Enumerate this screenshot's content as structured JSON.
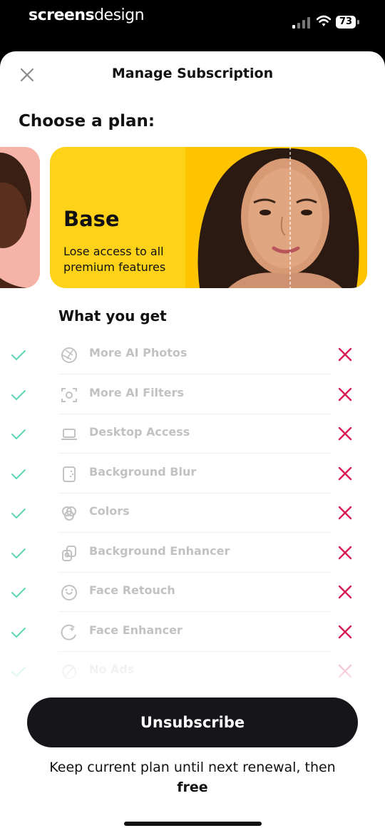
{
  "status_bar": {
    "brand_part1": "screens",
    "brand_part2": "design",
    "battery": "73"
  },
  "header": {
    "title": "Manage Subscription"
  },
  "section_title": "Choose a plan:",
  "plan_card": {
    "name": "Base",
    "description": "Lose access to all premium features"
  },
  "features_title": "What you get",
  "features": [
    {
      "label": "More AI Photos",
      "icon": "aperture-icon"
    },
    {
      "label": "More AI Filters",
      "icon": "face-scan-icon"
    },
    {
      "label": "Desktop Access",
      "icon": "laptop-icon"
    },
    {
      "label": "Background Blur",
      "icon": "blur-icon"
    },
    {
      "label": "Colors",
      "icon": "color-circles-icon"
    },
    {
      "label": "Background Enhancer",
      "icon": "enhance-icon"
    },
    {
      "label": "Face Retouch",
      "icon": "face-heart-icon"
    },
    {
      "label": "Face Enhancer",
      "icon": "face-sparkle-icon"
    },
    {
      "label": "No Ads",
      "icon": "no-ads-icon"
    }
  ],
  "colors": {
    "check": "#5fd6b5",
    "cross": "#d81b55",
    "card": "#ffd21a",
    "button": "#15151a"
  },
  "unsubscribe_label": "Unsubscribe",
  "note": {
    "text": "Keep current plan until next renewal, then",
    "emphasis": "free"
  }
}
